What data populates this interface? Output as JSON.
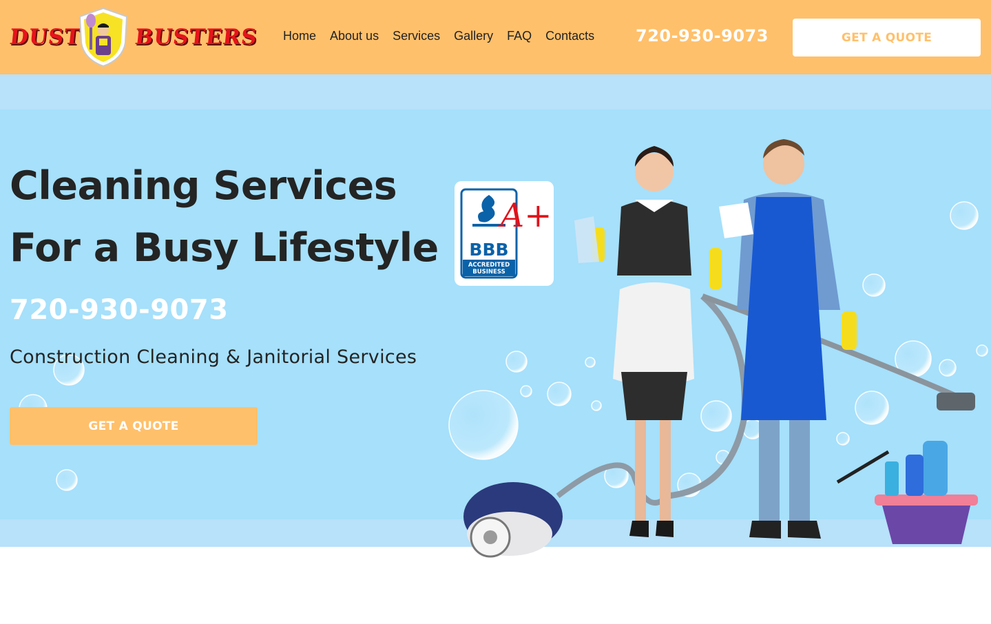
{
  "header": {
    "logo": {
      "word_left": "DUST",
      "word_right": "BUSTERS"
    },
    "nav": [
      "Home",
      "About us",
      "Services",
      "Gallery",
      "FAQ",
      "Contacts"
    ],
    "phone": "720-930-9073",
    "cta_label": "GET A QUOTE"
  },
  "hero": {
    "title_line1": "Cleaning Services",
    "title_line2": "For a Busy Lifestyle",
    "phone": "720-930-9073",
    "subtitle": "Construction Cleaning & Janitorial Services",
    "cta_label": "GET A QUOTE"
  },
  "bbb_badge": {
    "letters": "BBB",
    "rating": "A+",
    "caption_line1": "ACCREDITED",
    "caption_line2": "BUSINESS"
  },
  "colors": {
    "header_bg": "#ffc06b",
    "hero_bg": "#a6e0fb",
    "band_bg": "#b8e1fa",
    "cta_bg": "#ffc06b",
    "logo_red": "#e5141b",
    "bbb_blue": "#0a62a8",
    "rating_red": "#e0111b"
  }
}
